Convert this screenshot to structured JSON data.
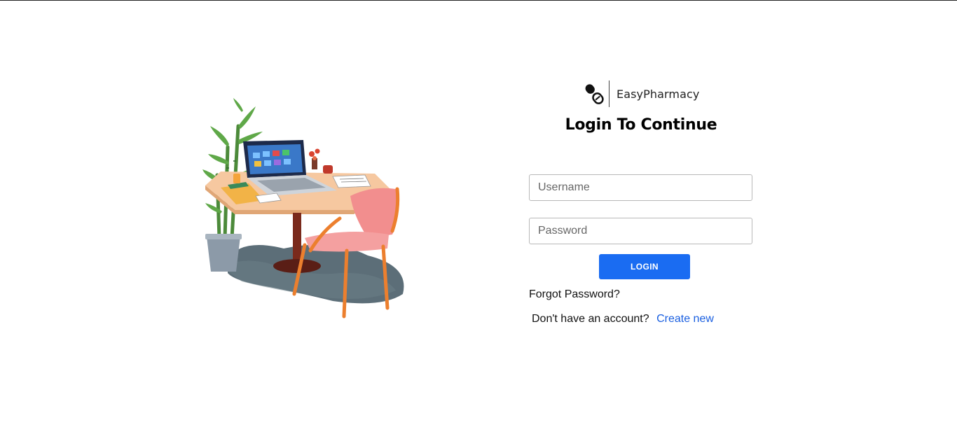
{
  "brand": {
    "name": "EasyPharmacy",
    "logo_icon": "pill-capsule-icon"
  },
  "login": {
    "title": "Login To Continue",
    "username_placeholder": "Username",
    "password_placeholder": "Password",
    "submit_label": "LOGIN",
    "forgot_label": "Forgot Password?",
    "no_account_text": "Don't have an account?",
    "create_label": "Create new"
  },
  "illustration": {
    "icon": "desk-workspace-illustration"
  },
  "colors": {
    "primary_button": "#1a6cf2",
    "link": "#1a5fe0",
    "chair": "#f28e8e",
    "desk": "#f6c8a0"
  }
}
